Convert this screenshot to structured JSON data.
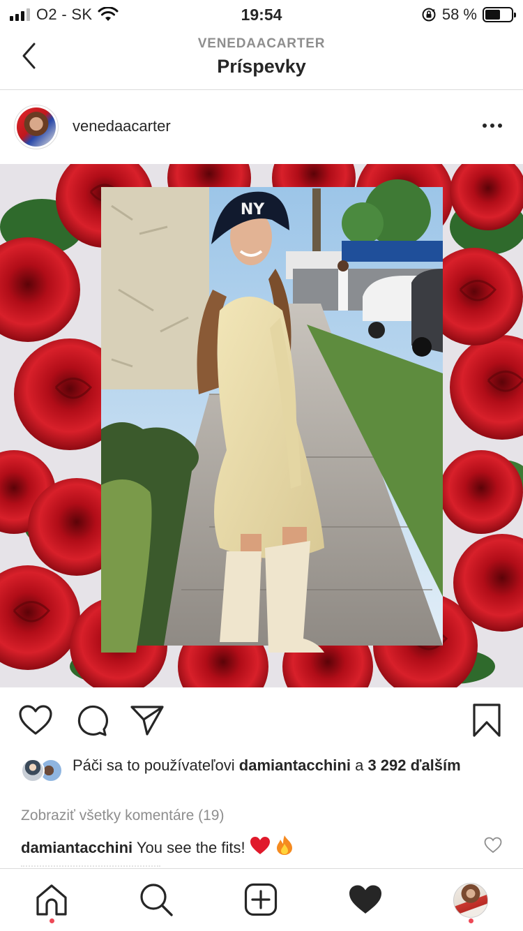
{
  "status_bar": {
    "carrier": "O2 - SK",
    "time": "19:54",
    "battery_text": "58 %",
    "battery_level": 0.58
  },
  "header": {
    "subtitle": "VENEDAACARTER",
    "title": "Príspevky"
  },
  "post": {
    "username": "venedaacarter",
    "likes": {
      "prefix": "Páči sa to používateľovi",
      "user": "damiantacchini",
      "middle": "a",
      "count": "3 292",
      "suffix": "ďalším"
    },
    "view_comments": "Zobraziť všetky komentáre (19)",
    "comment": {
      "user": "damiantacchini",
      "text": "You see the fits!"
    }
  },
  "icons": {
    "back": "chevron-left-icon",
    "more": "more-horizontal-icon",
    "like": "heart-outline-icon",
    "comment": "comment-bubble-icon",
    "share": "paper-plane-icon",
    "save": "bookmark-icon",
    "home": "home-icon",
    "search": "search-icon",
    "new_post": "plus-square-icon",
    "activity": "heart-filled-icon",
    "profile": "profile-avatar"
  },
  "colors": {
    "text": "#262626",
    "secondary": "#8e8e8e",
    "notification_dot": "#ed4956",
    "roses": "#c8141e",
    "fire": "#f58a1f"
  }
}
